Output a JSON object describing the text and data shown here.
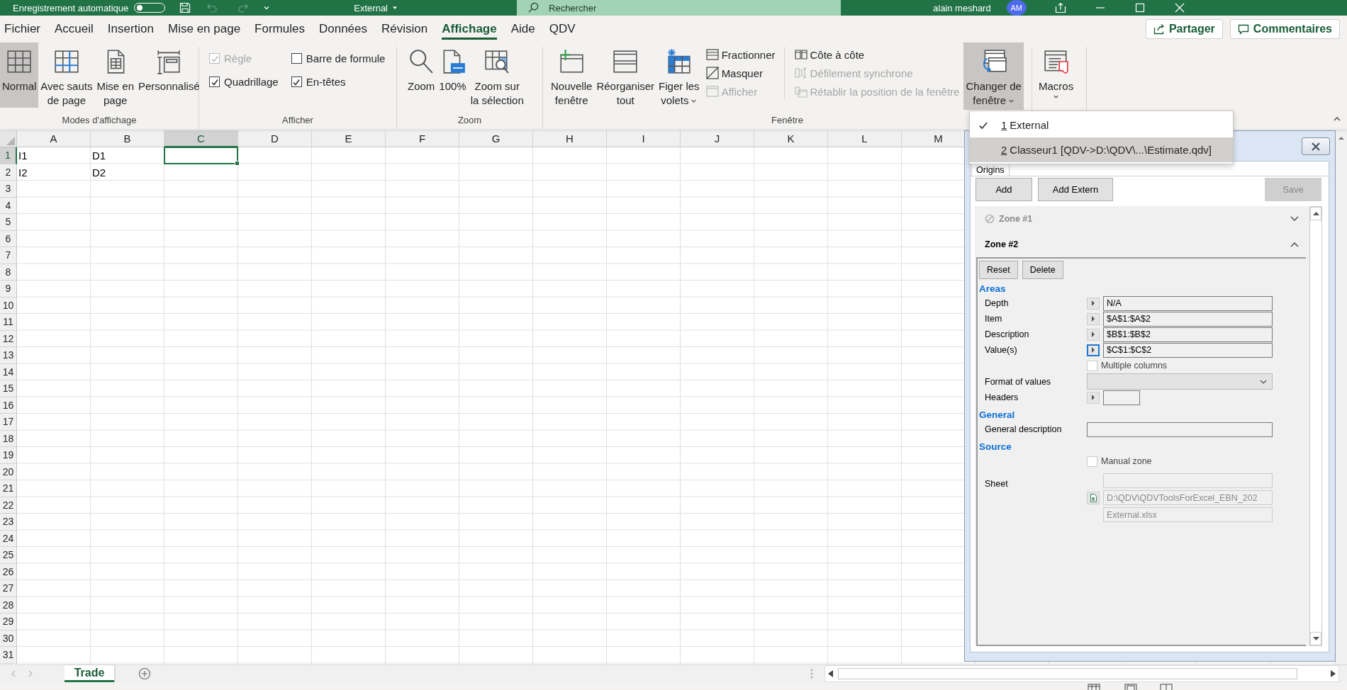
{
  "title_bar": {
    "autosave_label": "Enregistrement automatique",
    "autosave_on": false,
    "document": "External",
    "search": {
      "placeholder": "Rechercher"
    },
    "user": "alain meshard",
    "avatar": "AM"
  },
  "tabs": [
    {
      "label": "Fichier",
      "selected": false
    },
    {
      "label": "Accueil",
      "selected": false
    },
    {
      "label": "Insertion",
      "selected": false
    },
    {
      "label": "Mise en page",
      "selected": false
    },
    {
      "label": "Formules",
      "selected": false
    },
    {
      "label": "Données",
      "selected": false
    },
    {
      "label": "Révision",
      "selected": false
    },
    {
      "label": "Affichage",
      "selected": true
    },
    {
      "label": "Aide",
      "selected": false
    },
    {
      "label": "QDV",
      "selected": false
    }
  ],
  "share_button": "Partager",
  "comments_button": "Commentaires",
  "ribbon": {
    "groups": [
      {
        "label": "Modes d'affichage",
        "items": [
          {
            "kind": "large",
            "label": "Normal",
            "selected": true
          },
          {
            "kind": "large",
            "label": "Avec sauts\nde page",
            "selected": false
          },
          {
            "kind": "large",
            "label": "Mise en\npage",
            "selected": false
          },
          {
            "kind": "large",
            "label": "Personnalisé",
            "selected": false
          }
        ]
      },
      {
        "label": "Afficher",
        "items": [
          {
            "kind": "stack",
            "items": [
              {
                "kind": "check",
                "label": "Règle",
                "checked": true,
                "disabled": true
              },
              {
                "kind": "check",
                "label": "Quadrillage",
                "checked": true,
                "disabled": false
              }
            ]
          },
          {
            "kind": "stack",
            "items": [
              {
                "kind": "check",
                "label": "Barre de formule",
                "checked": false,
                "disabled": false
              },
              {
                "kind": "check",
                "label": "En-têtes",
                "checked": true,
                "disabled": false
              }
            ]
          }
        ]
      },
      {
        "label": "Zoom",
        "items": [
          {
            "kind": "large",
            "label": "Zoom"
          },
          {
            "kind": "large",
            "label": "100%"
          },
          {
            "kind": "large",
            "label": "Zoom sur\nla sélection"
          }
        ]
      },
      {
        "label": "Fenêtre",
        "items": [
          {
            "kind": "large",
            "label": "Nouvelle\nfenêtre"
          },
          {
            "kind": "large",
            "label": "Réorganiser\ntout"
          },
          {
            "kind": "large",
            "label": "Figer les\nvolets",
            "expanded": false
          },
          {
            "kind": "stack",
            "items": [
              {
                "kind": "small",
                "label": "Fractionner",
                "disabled": false
              },
              {
                "kind": "small",
                "label": "Masquer",
                "disabled": false
              },
              {
                "kind": "small",
                "label": "Afficher",
                "disabled": true
              }
            ]
          },
          {
            "kind": "stack",
            "items": [
              {
                "kind": "small",
                "label": "Côte à côte",
                "disabled": false
              },
              {
                "kind": "small",
                "label": "Défilement synchrone",
                "disabled": true
              },
              {
                "kind": "small",
                "label": "Rétablir la position de la fenêtre",
                "disabled": true
              }
            ]
          },
          {
            "kind": "large",
            "label": "Changer de\nfenêtre",
            "expanded": true
          }
        ]
      },
      {
        "items": [
          {
            "kind": "large",
            "label": "Macros",
            "expanded": false
          }
        ]
      }
    ]
  },
  "window_menu": {
    "items": [
      {
        "key": "1",
        "label": "External",
        "checked": true,
        "selected": false
      },
      {
        "key": "2",
        "label": "Classeur1 [QDV->D:\\QDV\\...\\Estimate.qdv]",
        "checked": false,
        "selected": true
      }
    ]
  },
  "sheet": {
    "columns": [
      {
        "label": "A",
        "selected": false
      },
      {
        "label": "B",
        "selected": false
      },
      {
        "label": "C",
        "selected": true
      },
      {
        "label": "D",
        "selected": false
      },
      {
        "label": "E",
        "selected": false
      },
      {
        "label": "F",
        "selected": false
      },
      {
        "label": "G",
        "selected": false
      },
      {
        "label": "H",
        "selected": false
      },
      {
        "label": "I",
        "selected": false
      },
      {
        "label": "J",
        "selected": false
      },
      {
        "label": "K",
        "selected": false
      },
      {
        "label": "L",
        "selected": false
      },
      {
        "label": "M",
        "selected": false
      }
    ],
    "rows": [
      {
        "label": "1",
        "selected": true,
        "cells": [
          {
            "text": "I1",
            "selected": false
          },
          {
            "text": "D1",
            "selected": false
          },
          {
            "selected": true
          }
        ]
      },
      {
        "label": "2",
        "selected": false,
        "cells": [
          {
            "text": "I2",
            "selected": false
          },
          {
            "text": "D2",
            "selected": false
          }
        ]
      },
      {
        "label": "3",
        "selected": false
      },
      {
        "label": "4",
        "selected": false
      },
      {
        "label": "5",
        "selected": false
      },
      {
        "label": "6",
        "selected": false
      },
      {
        "label": "7",
        "selected": false
      },
      {
        "label": "8",
        "selected": false
      },
      {
        "label": "9",
        "selected": false
      },
      {
        "label": "10",
        "selected": false
      },
      {
        "label": "11",
        "selected": false
      },
      {
        "label": "12",
        "selected": false
      },
      {
        "label": "13",
        "selected": false
      },
      {
        "label": "14",
        "selected": false
      },
      {
        "label": "15",
        "selected": false
      },
      {
        "label": "16",
        "selected": false
      },
      {
        "label": "17",
        "selected": false
      },
      {
        "label": "18",
        "selected": false
      },
      {
        "label": "19",
        "selected": false
      },
      {
        "label": "20",
        "selected": false
      },
      {
        "label": "21",
        "selected": false
      },
      {
        "label": "22",
        "selected": false
      },
      {
        "label": "23",
        "selected": false
      },
      {
        "label": "24",
        "selected": false
      },
      {
        "label": "25",
        "selected": false
      },
      {
        "label": "26",
        "selected": false
      },
      {
        "label": "27",
        "selected": false
      },
      {
        "label": "28",
        "selected": false
      },
      {
        "label": "29",
        "selected": false
      },
      {
        "label": "30",
        "selected": false
      },
      {
        "label": "31",
        "selected": false
      }
    ]
  },
  "qdv_panel": {
    "tabs": [
      {
        "label": "Origins",
        "selected": true
      }
    ],
    "buttons": [
      {
        "label": "Add",
        "disabled": false
      },
      {
        "label": "Add Extern",
        "disabled": false
      },
      {
        "label": "Save",
        "disabled": true
      }
    ],
    "zones": [
      {
        "title": "Zone #1",
        "disabled": true,
        "expanded": false
      },
      {
        "title": "Zone #2",
        "disabled": false,
        "expanded": true,
        "buttons": [
          "Reset",
          "Delete"
        ],
        "sections": [
          {
            "heading": "Areas",
            "rows": [
              {
                "kind": "range",
                "label": "Depth",
                "value": "N/A",
                "focused": false
              },
              {
                "kind": "range",
                "label": "Item",
                "value": "$A$1:$A$2",
                "focused": false
              },
              {
                "kind": "range",
                "label": "Description",
                "value": "$B$1:$B$2",
                "focused": false
              },
              {
                "kind": "range",
                "label": "Value(s)",
                "value": "$C$1:$C$2",
                "focused": true
              },
              {
                "kind": "check",
                "label": "Multiple columns",
                "checked": false
              },
              {
                "kind": "select",
                "label": "Format of values"
              },
              {
                "kind": "range_short",
                "label": "Headers",
                "focused": false
              }
            ]
          },
          {
            "heading": "General",
            "rows": [
              {
                "kind": "text",
                "label": "General description"
              }
            ]
          },
          {
            "heading": "Source",
            "rows": [
              {
                "kind": "check",
                "label": "Manual zone",
                "checked": false
              },
              {
                "kind": "sheet",
                "label": "Sheet",
                "path": "D:\\QDV\\QDVToolsForExcel_EBN_202",
                "file": "External.xlsx"
              }
            ]
          }
        ]
      }
    ]
  },
  "sheet_tabs": [
    {
      "label": "Trade",
      "selected": true
    }
  ]
}
